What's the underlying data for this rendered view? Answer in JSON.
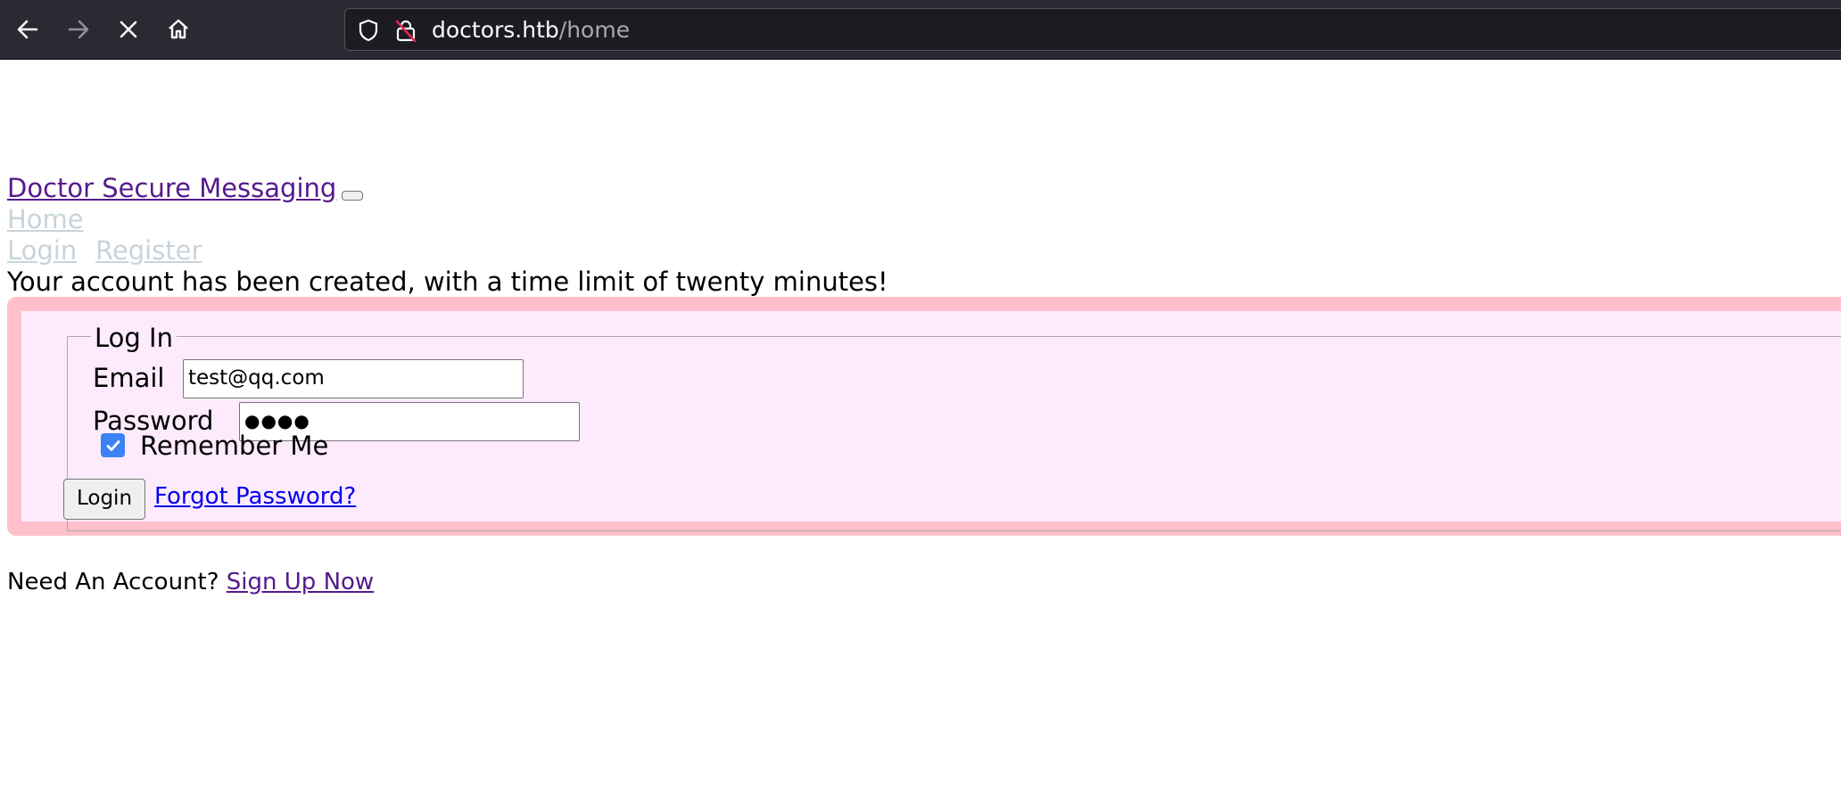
{
  "browser": {
    "url_host": "doctors.htb",
    "url_path": "/home",
    "icons": [
      "back-arrow-icon",
      "forward-arrow-icon",
      "stop-icon",
      "home-icon",
      "shield-icon",
      "insecure-lock-icon"
    ]
  },
  "navbar": {
    "brand": "Doctor Secure Messaging",
    "home": "Home",
    "login": "Login",
    "register": "Register"
  },
  "flash_message": "Your account has been created, with a time limit of twenty minutes!",
  "form": {
    "legend": "Log In",
    "email_label": "Email",
    "email_value": "test@qq.com",
    "password_label": "Password",
    "password_value": "●●●●",
    "remember_label": "Remember Me",
    "remember_checked": true,
    "login_button": "Login",
    "forgot_link": "Forgot Password?"
  },
  "footer": {
    "need_account": "Need An Account?",
    "signup_link": "Sign Up Now"
  },
  "colors": {
    "pink_border": "#ffc0cb",
    "pink_bg": "#fdebfd",
    "visited_link": "#551a8b",
    "link": "#0000ee",
    "checkbox_accent": "#3b82f6"
  }
}
